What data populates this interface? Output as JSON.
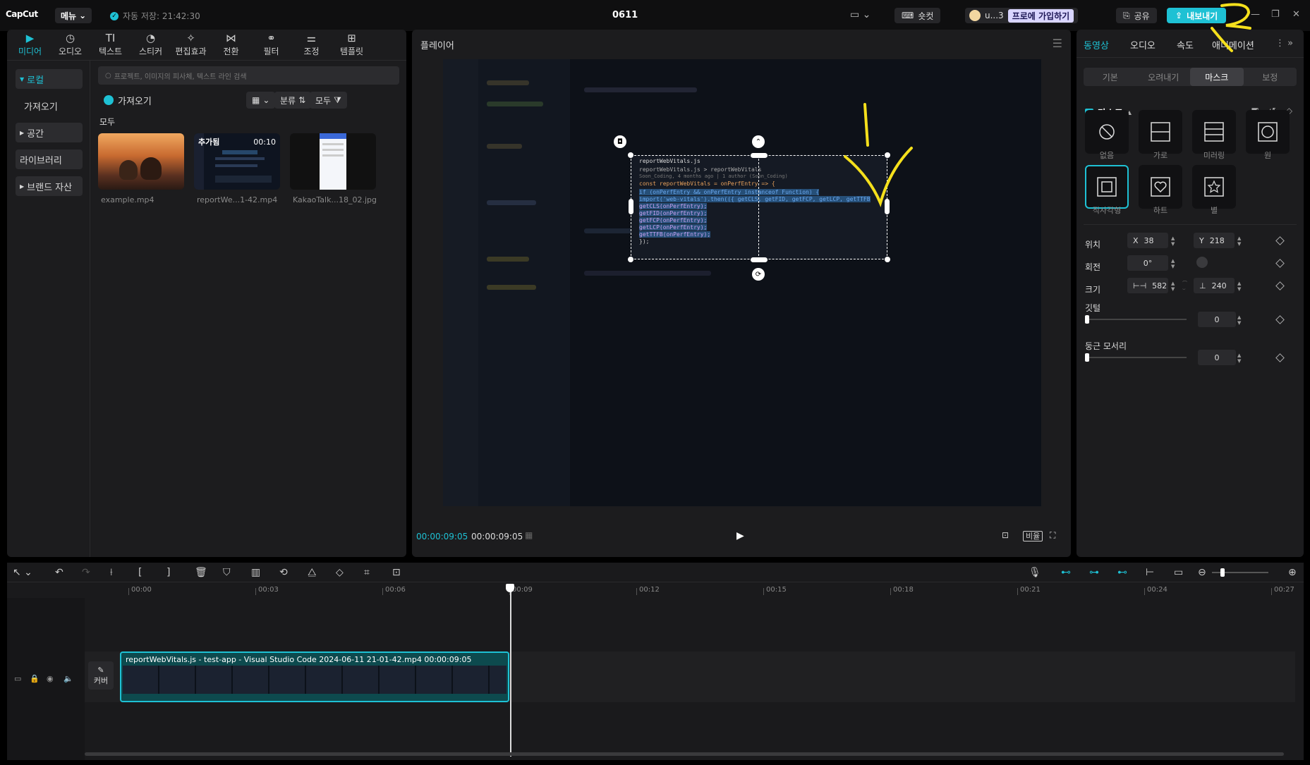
{
  "topbar": {
    "logo": "CapCut",
    "menu_label": "메뉴",
    "autosave": "자동 저장: 21:42:30",
    "project_title": "0611",
    "shortcut_label": "숏컷",
    "user_name": "u...3",
    "pro_label": "프로에 가입하기",
    "share_label": "공유",
    "export_label": "내보내기"
  },
  "left": {
    "tabs": [
      {
        "label": "미디어",
        "icon": "media-icon"
      },
      {
        "label": "오디오",
        "icon": "audio-icon"
      },
      {
        "label": "텍스트",
        "icon": "text-icon"
      },
      {
        "label": "스티커",
        "icon": "sticker-icon"
      },
      {
        "label": "편집효과",
        "icon": "effects-icon"
      },
      {
        "label": "전환",
        "icon": "transition-icon"
      },
      {
        "label": "필터",
        "icon": "filter-icon"
      },
      {
        "label": "조정",
        "icon": "adjust-icon"
      },
      {
        "label": "템플릿",
        "icon": "template-icon"
      }
    ],
    "sidebar": {
      "local": "로컬",
      "import": "가져오기",
      "space": "공간",
      "library": "라이브러리",
      "brand": "브랜드 자산"
    },
    "search_placeholder": "프로젝트, 이미지의 피사체, 텍스트 라인 검색",
    "import_label": "가져오기",
    "sort_label": "분류",
    "filter_label": "모두",
    "all_label": "모두",
    "media": [
      {
        "name": "example.mp4",
        "tag": "",
        "duration": ""
      },
      {
        "name": "reportWe...1-42.mp4",
        "tag": "추가됨",
        "duration": "00:10"
      },
      {
        "name": "KakaoTalk...18_02.jpg",
        "tag": "",
        "duration": ""
      }
    ]
  },
  "player": {
    "title": "플레이어",
    "current_time": "00:00:09:05",
    "total_time": "00:00:09:05",
    "ratio_label": "비율",
    "code": {
      "tab1": "reportWebVitals.js",
      "breadcrumb": "reportWebVitals.js > reportWebVitals",
      "author": "Soon_Coding, 4 months ago | 1 author (Soon_Coding)",
      "lines": [
        "const reportWebVitals = onPerfEntry => {",
        "  if (onPerfEntry && onPerfEntry instanceof Function) {",
        "    import('web-vitals').then(({ getCLS, getFID, getFCP, getLCP, getTTFB",
        "      getCLS(onPerfEntry);",
        "      getFID(onPerfEntry);",
        "      getFCP(onPerfEntry);",
        "      getLCP(onPerfEntry);",
        "      getTTFB(onPerfEntry);",
        "    });"
      ]
    }
  },
  "right": {
    "tabs": [
      "동영상",
      "오디오",
      "속도",
      "애니메이션"
    ],
    "sub_tabs": [
      "기본",
      "오려내기",
      "마스크",
      "보정"
    ],
    "mask_title": "마스크",
    "shapes": [
      {
        "label": "없음",
        "icon": "none-icon"
      },
      {
        "label": "가로",
        "icon": "horizontal-icon"
      },
      {
        "label": "미러링",
        "icon": "mirror-icon"
      },
      {
        "label": "원",
        "icon": "circle-icon"
      },
      {
        "label": "직사각형",
        "icon": "rectangle-icon"
      },
      {
        "label": "하트",
        "icon": "heart-icon"
      },
      {
        "label": "별",
        "icon": "star-icon"
      }
    ],
    "position_label": "위치",
    "x_label": "X",
    "x_value": "38",
    "y_label": "Y",
    "y_value": "218",
    "rotation_label": "회전",
    "rotation_value": "0°",
    "size_label": "크기",
    "width_value": "582",
    "height_value": "240",
    "feather_label": "깃털",
    "feather_value": "0",
    "round_label": "둥근 모서리",
    "round_value": "0"
  },
  "timeline": {
    "ticks": [
      "00:00",
      "00:03",
      "00:06",
      "00:09",
      "00:12",
      "00:15",
      "00:18",
      "00:21",
      "00:24",
      "00:27"
    ],
    "clip_label": "reportWebVitals.js - test-app - Visual Studio Code 2024-06-11 21-01-42.mp4   00:00:09:05",
    "cover_label": "커버"
  },
  "colors": {
    "accent": "#1ec1d4",
    "annotation": "#f5e01c"
  }
}
